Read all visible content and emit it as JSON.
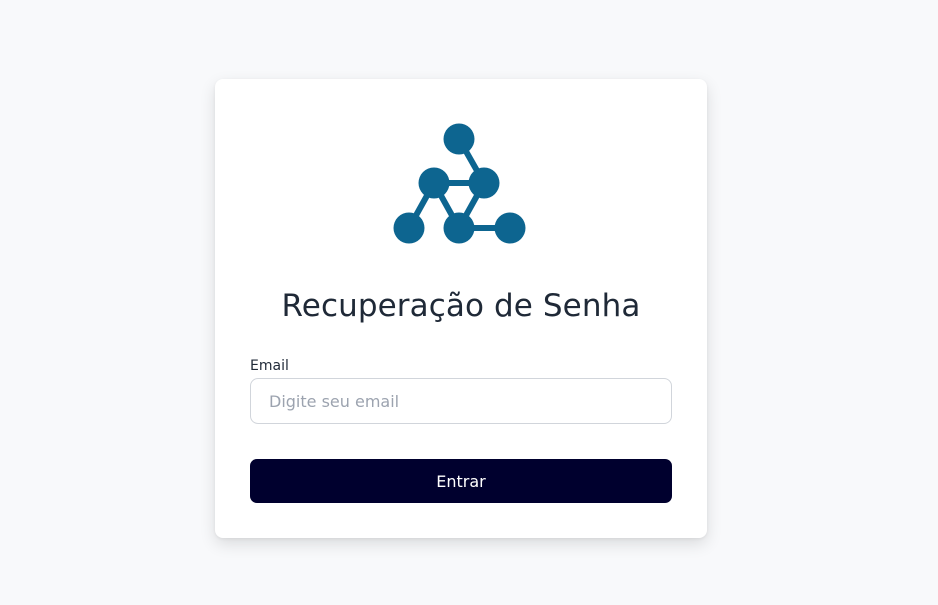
{
  "brand": {
    "logo_icon": "molecule-network-icon",
    "color": "#0d6590"
  },
  "page": {
    "title": "Recuperação de Senha"
  },
  "form": {
    "email_label": "Email",
    "email_placeholder": "Digite seu email",
    "email_value": "",
    "submit_label": "Entrar"
  },
  "colors": {
    "background": "#f8f9fb",
    "card": "#ffffff",
    "button": "#00002e",
    "button_text": "#ffffff",
    "title": "#1f2937"
  }
}
